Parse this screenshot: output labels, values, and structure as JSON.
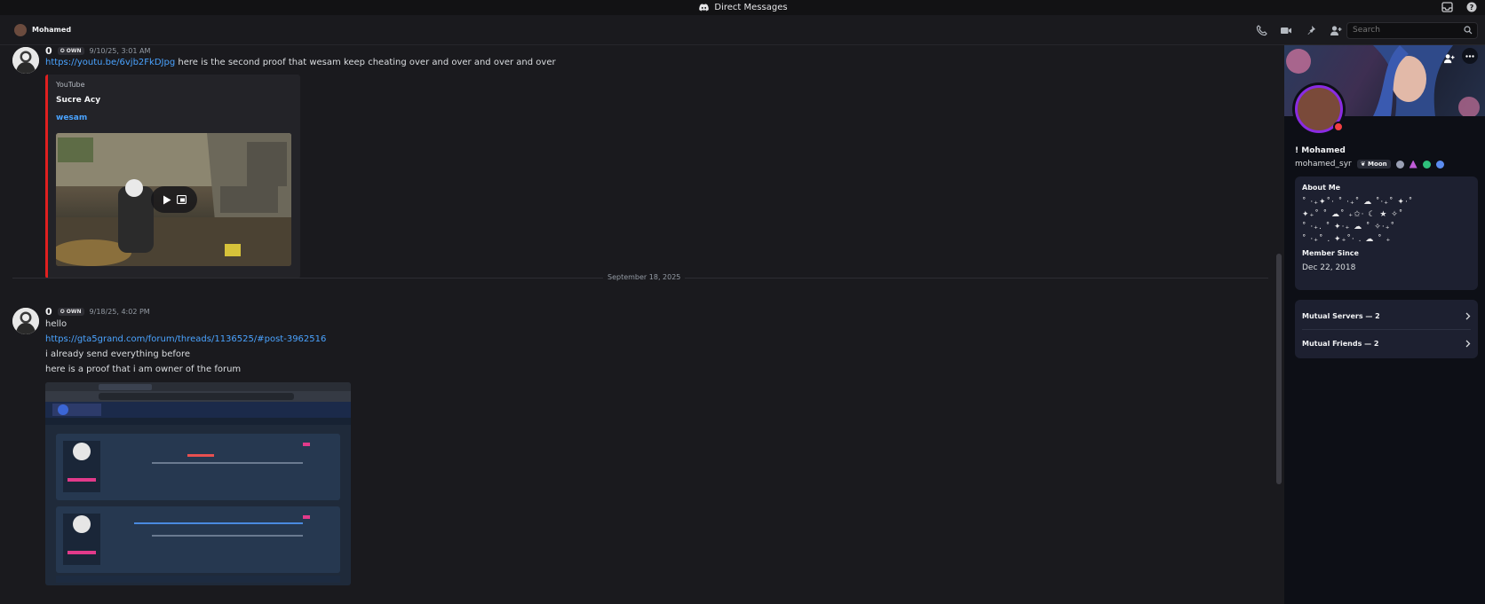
{
  "window": {
    "title": "Direct Messages"
  },
  "header": {
    "name": "Mohamed",
    "search_placeholder": "Search"
  },
  "messages": [
    {
      "author": "0",
      "tag": "OWN",
      "time": "9/10/25, 3:01 AM",
      "link": "https://youtu.be/6vjb2FkDJpg",
      "text": "here is the second proof that wesam keep cheating over and over and over and over",
      "embed": {
        "provider": "YouTube",
        "author": "Sucre Acy",
        "title": "wesam"
      }
    },
    {
      "author": "0",
      "tag": "OWN",
      "time": "9/18/25, 4:02 PM",
      "lines": [
        "hello",
        "https://gta5grand.com/forum/threads/1136525/#post-3962516",
        "i already send everything before",
        "here is a proof that i am owner of the forum"
      ]
    }
  ],
  "divider": "September 18, 2025",
  "profile": {
    "display_name": "Mohamed",
    "username": "mohamed_syr",
    "clan_tag": "Moon",
    "about_title": "About Me",
    "about_text": "˚ ‧₊✦˚‧ ˚ ‧₊˚ ☁ ˚‧₊˚ ✦‧˚\n✦₊˚ ˚ ☁˚ ₊✩‧ ☾ ★ ✧˚\n˚ ‧₊. ˚ ✦‧₊ ☁ ˚ ✧‧₊˚\n˚ ‧₊˚ . ✦₊˚‧ . ☁ ˚ ₊",
    "member_since_title": "Member Since",
    "member_since": "Dec 22, 2018",
    "mutual_servers": "Mutual Servers — 2",
    "mutual_friends": "Mutual Friends — 2"
  },
  "colors": {
    "accent": "#8a2be2",
    "link": "#4aa3ff",
    "embed_border": "#e02020",
    "status": "#f23f42"
  },
  "icons": [
    "discord-icon",
    "inbox-icon",
    "help-icon",
    "call-icon",
    "video-icon",
    "pin-icon",
    "add-friend-icon",
    "profile-icon",
    "search-icon",
    "more-icon",
    "chevron-right-icon"
  ]
}
